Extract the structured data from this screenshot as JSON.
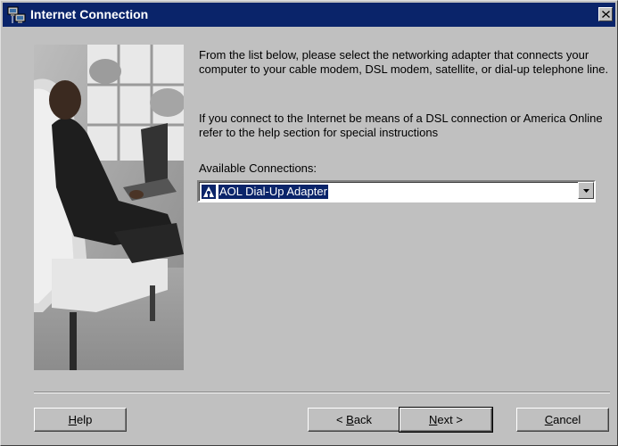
{
  "window": {
    "title": "Internet Connection"
  },
  "instructions": {
    "paragraph1": "From the list below, please select the networking adapter that connects your computer to your cable modem, DSL modem, satellite, or dial-up telephone line.",
    "paragraph2": "If you connect to the Internet be means of a DSL connection or America Online refer to the help section for special instructions"
  },
  "connections": {
    "label": "Available Connections:",
    "selected": "AOL Dial-Up Adapter"
  },
  "buttons": {
    "help": {
      "mnemonic": "H",
      "rest": "elp"
    },
    "back": {
      "prefix": "< ",
      "mnemonic": "B",
      "rest": "ack"
    },
    "next": {
      "mnemonic": "N",
      "rest": "ext >"
    },
    "cancel": {
      "mnemonic": "C",
      "rest": "ancel"
    }
  },
  "colors": {
    "titlebar": "#0a246a",
    "face": "#c0c0c0",
    "selection": "#0a246a"
  },
  "icons": {
    "title": "network-computers-icon",
    "close": "close-icon",
    "adapter": "aol-triangle-man-icon",
    "dropdown": "chevron-down-icon"
  }
}
